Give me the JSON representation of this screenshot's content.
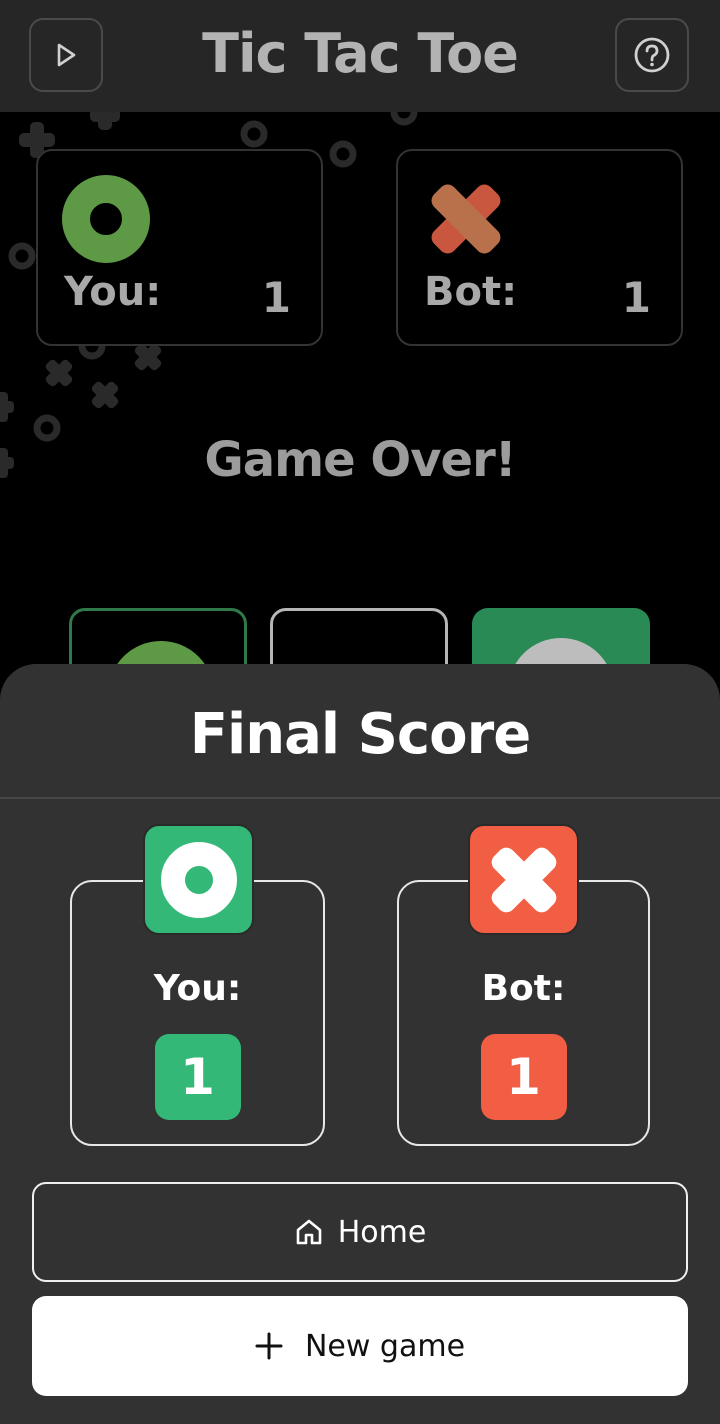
{
  "header": {
    "title": "Tic Tac Toe",
    "play_icon": "play-icon",
    "help_icon": "help-circle-icon"
  },
  "scoreboard": {
    "you": {
      "label": "You:",
      "score": "1",
      "icon": "circle-marker-icon",
      "color": "#5e9a45"
    },
    "bot": {
      "label": "Bot:",
      "score": "1",
      "icon": "cross-marker-icon",
      "color": "#c9563f"
    }
  },
  "status": "Game Over!",
  "final_score": {
    "title": "Final Score",
    "you": {
      "label": "You:",
      "score": "1",
      "color": "#33b877"
    },
    "bot": {
      "label": "Bot:",
      "score": "1",
      "color": "#f25e44"
    }
  },
  "actions": {
    "home_label": "Home",
    "home_icon": "home-icon",
    "new_game_label": "New game",
    "new_game_icon": "plus-icon"
  }
}
